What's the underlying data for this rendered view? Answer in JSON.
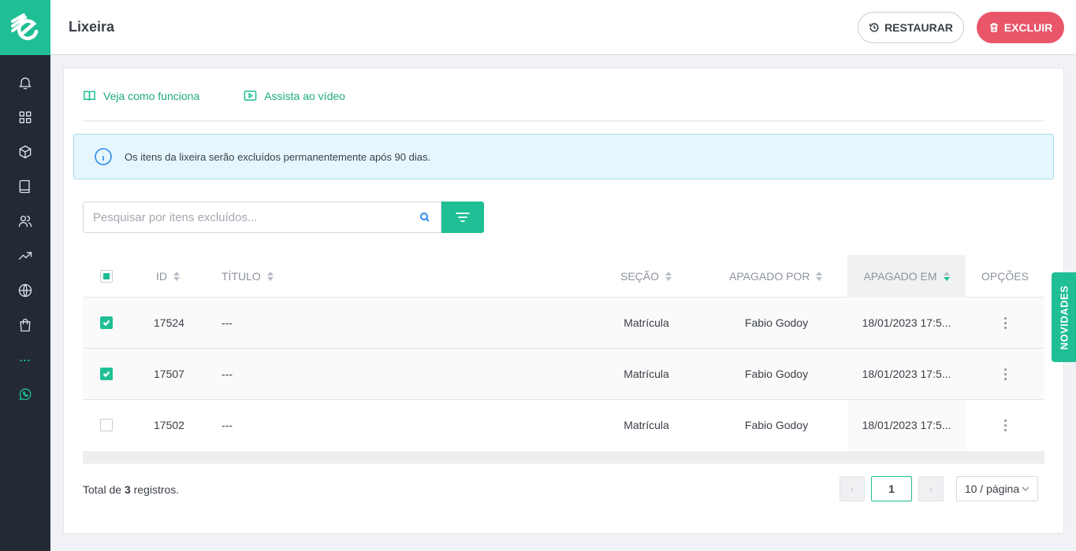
{
  "header": {
    "title": "Lixeira",
    "restore_label": "RESTAURAR",
    "delete_label": "EXCLUIR"
  },
  "help_links": {
    "how_it_works": "Veja como funciona",
    "watch_video": "Assista ao vídeo"
  },
  "alert": {
    "text": "Os itens da lixeira serão excluídos permanentemente após 90 dias."
  },
  "search": {
    "placeholder": "Pesquisar por itens excluídos..."
  },
  "table": {
    "columns": {
      "id": "ID",
      "title": "TÍTULO",
      "section": "SEÇÃO",
      "deleted_by": "APAGADO POR",
      "deleted_at": "APAGADO EM",
      "options": "OPÇÕES"
    },
    "rows": [
      {
        "id": "17524",
        "title": "---",
        "section": "Matrícula",
        "deleted_by": "Fabio Godoy",
        "deleted_at": "18/01/2023 17:5...",
        "checked": true
      },
      {
        "id": "17507",
        "title": "---",
        "section": "Matrícula",
        "deleted_by": "Fabio Godoy",
        "deleted_at": "18/01/2023 17:5...",
        "checked": true
      },
      {
        "id": "17502",
        "title": "---",
        "section": "Matrícula",
        "deleted_by": "Fabio Godoy",
        "deleted_at": "18/01/2023 17:5...",
        "checked": false
      }
    ]
  },
  "footer": {
    "total_prefix": "Total de",
    "total_count": "3",
    "total_suffix": "registros.",
    "current_page": "1",
    "page_size": "10 / página"
  },
  "novidades_label": "NOVIDADES",
  "sidebar": {
    "more_label": "..."
  },
  "colors": {
    "accent": "#1fbe95",
    "danger": "#e9566a",
    "sidebar": "#232a36",
    "info": "#2b8ce8"
  }
}
